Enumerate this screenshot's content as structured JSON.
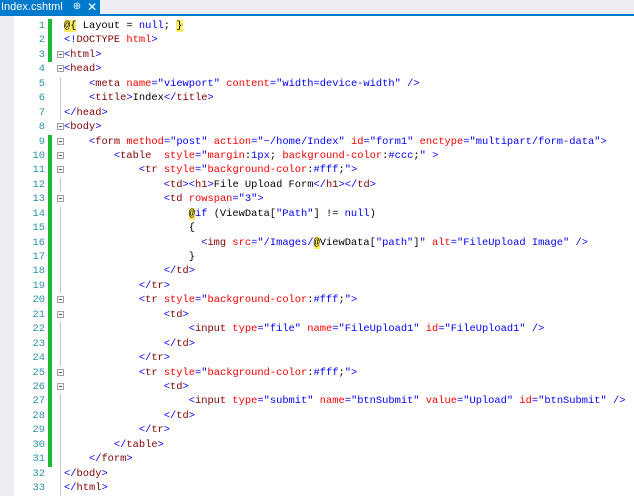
{
  "tab": {
    "title": "Index.cshtml",
    "pin": "⊕",
    "close": "✕"
  },
  "code": {
    "lines": [
      {
        "n": "1",
        "tokens": [
          [
            "r",
            "@{"
          ],
          [
            "x",
            " Layout = "
          ],
          [
            "k",
            "null"
          ],
          [
            "x",
            "; "
          ],
          [
            "r",
            "}"
          ]
        ]
      },
      {
        "n": "2",
        "tokens": [
          [
            "d",
            "<!"
          ],
          [
            "t",
            "DOCTYPE"
          ],
          [
            "x",
            " "
          ],
          [
            "a",
            "html"
          ],
          [
            "d",
            ">"
          ]
        ]
      },
      {
        "n": "3",
        "tokens": [
          [
            "d",
            "<"
          ],
          [
            "t",
            "html"
          ],
          [
            "d",
            ">"
          ]
        ]
      },
      {
        "n": "4",
        "tokens": [
          [
            "d",
            "<"
          ],
          [
            "t",
            "head"
          ],
          [
            "d",
            ">"
          ]
        ]
      },
      {
        "n": "5",
        "tokens": [
          [
            "x",
            "    "
          ],
          [
            "d",
            "<"
          ],
          [
            "t",
            "meta"
          ],
          [
            "x",
            " "
          ],
          [
            "a",
            "name"
          ],
          [
            "d",
            "="
          ],
          [
            "v",
            "\"viewport\""
          ],
          [
            "x",
            " "
          ],
          [
            "a",
            "content"
          ],
          [
            "d",
            "="
          ],
          [
            "v",
            "\"width=device-width\""
          ],
          [
            "x",
            " "
          ],
          [
            "d",
            "/>"
          ]
        ]
      },
      {
        "n": "6",
        "tokens": [
          [
            "x",
            "    "
          ],
          [
            "d",
            "<"
          ],
          [
            "t",
            "title"
          ],
          [
            "d",
            ">"
          ],
          [
            "x",
            "Index"
          ],
          [
            "d",
            "</"
          ],
          [
            "t",
            "title"
          ],
          [
            "d",
            ">"
          ]
        ]
      },
      {
        "n": "7",
        "tokens": [
          [
            "d",
            "</"
          ],
          [
            "t",
            "head"
          ],
          [
            "d",
            ">"
          ]
        ]
      },
      {
        "n": "8",
        "tokens": [
          [
            "d",
            "<"
          ],
          [
            "t",
            "body"
          ],
          [
            "d",
            ">"
          ]
        ]
      },
      {
        "n": "9",
        "tokens": [
          [
            "x",
            "    "
          ],
          [
            "d",
            "<"
          ],
          [
            "t",
            "form"
          ],
          [
            "x",
            " "
          ],
          [
            "a",
            "method"
          ],
          [
            "d",
            "="
          ],
          [
            "v",
            "\"post\""
          ],
          [
            "x",
            " "
          ],
          [
            "a",
            "action"
          ],
          [
            "d",
            "="
          ],
          [
            "v",
            "\"~/home/Index\""
          ],
          [
            "x",
            " "
          ],
          [
            "a",
            "id"
          ],
          [
            "d",
            "="
          ],
          [
            "v",
            "\"form1\""
          ],
          [
            "x",
            " "
          ],
          [
            "a",
            "enctype"
          ],
          [
            "d",
            "="
          ],
          [
            "v",
            "\"multipart/form-data\""
          ],
          [
            "d",
            ">"
          ]
        ]
      },
      {
        "n": "10",
        "tokens": [
          [
            "x",
            "        "
          ],
          [
            "d",
            "<"
          ],
          [
            "t",
            "table"
          ],
          [
            "x",
            "  "
          ],
          [
            "a",
            "style"
          ],
          [
            "d",
            "="
          ],
          [
            "v",
            "\""
          ],
          [
            "a",
            "margin"
          ],
          [
            "x",
            ":"
          ],
          [
            "v",
            "1px"
          ],
          [
            "x",
            "; "
          ],
          [
            "a",
            "background-color"
          ],
          [
            "x",
            ":"
          ],
          [
            "v",
            "#ccc"
          ],
          [
            "x",
            ";"
          ],
          [
            "v",
            "\""
          ],
          [
            "x",
            " "
          ],
          [
            "d",
            ">"
          ]
        ]
      },
      {
        "n": "11",
        "tokens": [
          [
            "x",
            "            "
          ],
          [
            "d",
            "<"
          ],
          [
            "t",
            "tr"
          ],
          [
            "x",
            " "
          ],
          [
            "a",
            "style"
          ],
          [
            "d",
            "="
          ],
          [
            "v",
            "\""
          ],
          [
            "a",
            "background-color"
          ],
          [
            "x",
            ":"
          ],
          [
            "v",
            "#fff"
          ],
          [
            "x",
            ";"
          ],
          [
            "v",
            "\""
          ],
          [
            "d",
            ">"
          ]
        ]
      },
      {
        "n": "12",
        "tokens": [
          [
            "x",
            "                "
          ],
          [
            "d",
            "<"
          ],
          [
            "t",
            "td"
          ],
          [
            "d",
            "><"
          ],
          [
            "t",
            "h1"
          ],
          [
            "d",
            ">"
          ],
          [
            "x",
            "File Upload Form"
          ],
          [
            "d",
            "</"
          ],
          [
            "t",
            "h1"
          ],
          [
            "d",
            "></"
          ],
          [
            "t",
            "td"
          ],
          [
            "d",
            ">"
          ]
        ]
      },
      {
        "n": "13",
        "tokens": [
          [
            "x",
            "                "
          ],
          [
            "d",
            "<"
          ],
          [
            "t",
            "td"
          ],
          [
            "x",
            " "
          ],
          [
            "a",
            "rowspan"
          ],
          [
            "d",
            "="
          ],
          [
            "v",
            "\"3\""
          ],
          [
            "d",
            ">"
          ]
        ]
      },
      {
        "n": "14",
        "tokens": [
          [
            "x",
            "                    "
          ],
          [
            "r",
            "@"
          ],
          [
            "k",
            "if"
          ],
          [
            "x",
            " (ViewData["
          ],
          [
            "v",
            "\"Path\""
          ],
          [
            "x",
            "] != "
          ],
          [
            "k",
            "null"
          ],
          [
            "x",
            ")"
          ]
        ]
      },
      {
        "n": "15",
        "tokens": [
          [
            "x",
            "                    {"
          ]
        ]
      },
      {
        "n": "16",
        "tokens": [
          [
            "x",
            "                      "
          ],
          [
            "d",
            "<"
          ],
          [
            "t",
            "img"
          ],
          [
            "x",
            " "
          ],
          [
            "a",
            "src"
          ],
          [
            "d",
            "="
          ],
          [
            "v",
            "\"/Images/"
          ],
          [
            "r",
            "@"
          ],
          [
            "x",
            "ViewData["
          ],
          [
            "v",
            "\"path\""
          ],
          [
            "x",
            "]"
          ],
          [
            "v",
            "\""
          ],
          [
            "x",
            " "
          ],
          [
            "a",
            "alt"
          ],
          [
            "d",
            "="
          ],
          [
            "v",
            "\"FileUpload Image\""
          ],
          [
            "x",
            " "
          ],
          [
            "d",
            "/>"
          ]
        ]
      },
      {
        "n": "17",
        "tokens": [
          [
            "x",
            "                    }"
          ]
        ]
      },
      {
        "n": "18",
        "tokens": [
          [
            "x",
            "                "
          ],
          [
            "d",
            "</"
          ],
          [
            "t",
            "td"
          ],
          [
            "d",
            ">"
          ]
        ]
      },
      {
        "n": "19",
        "tokens": [
          [
            "x",
            "            "
          ],
          [
            "d",
            "</"
          ],
          [
            "t",
            "tr"
          ],
          [
            "d",
            ">"
          ]
        ]
      },
      {
        "n": "20",
        "tokens": [
          [
            "x",
            "            "
          ],
          [
            "d",
            "<"
          ],
          [
            "t",
            "tr"
          ],
          [
            "x",
            " "
          ],
          [
            "a",
            "style"
          ],
          [
            "d",
            "="
          ],
          [
            "v",
            "\""
          ],
          [
            "a",
            "background-color"
          ],
          [
            "x",
            ":"
          ],
          [
            "v",
            "#fff"
          ],
          [
            "x",
            ";"
          ],
          [
            "v",
            "\""
          ],
          [
            "d",
            ">"
          ]
        ]
      },
      {
        "n": "21",
        "tokens": [
          [
            "x",
            "                "
          ],
          [
            "d",
            "<"
          ],
          [
            "t",
            "td"
          ],
          [
            "d",
            ">"
          ]
        ]
      },
      {
        "n": "22",
        "tokens": [
          [
            "x",
            "                    "
          ],
          [
            "d",
            "<"
          ],
          [
            "t",
            "input"
          ],
          [
            "x",
            " "
          ],
          [
            "a",
            "type"
          ],
          [
            "d",
            "="
          ],
          [
            "v",
            "\"file\""
          ],
          [
            "x",
            " "
          ],
          [
            "a",
            "name"
          ],
          [
            "d",
            "="
          ],
          [
            "v",
            "\"FileUpload1\""
          ],
          [
            "x",
            " "
          ],
          [
            "a",
            "id"
          ],
          [
            "d",
            "="
          ],
          [
            "v",
            "\"FileUpload1\""
          ],
          [
            "x",
            " "
          ],
          [
            "d",
            "/>"
          ]
        ]
      },
      {
        "n": "23",
        "tokens": [
          [
            "x",
            "                "
          ],
          [
            "d",
            "</"
          ],
          [
            "t",
            "td"
          ],
          [
            "d",
            ">"
          ]
        ]
      },
      {
        "n": "24",
        "tokens": [
          [
            "x",
            "            "
          ],
          [
            "d",
            "</"
          ],
          [
            "t",
            "tr"
          ],
          [
            "d",
            ">"
          ]
        ]
      },
      {
        "n": "25",
        "tokens": [
          [
            "x",
            "            "
          ],
          [
            "d",
            "<"
          ],
          [
            "t",
            "tr"
          ],
          [
            "x",
            " "
          ],
          [
            "a",
            "style"
          ],
          [
            "d",
            "="
          ],
          [
            "v",
            "\""
          ],
          [
            "a",
            "background-color"
          ],
          [
            "x",
            ":"
          ],
          [
            "v",
            "#fff"
          ],
          [
            "x",
            ";"
          ],
          [
            "v",
            "\""
          ],
          [
            "d",
            ">"
          ]
        ]
      },
      {
        "n": "26",
        "tokens": [
          [
            "x",
            "                "
          ],
          [
            "d",
            "<"
          ],
          [
            "t",
            "td"
          ],
          [
            "d",
            ">"
          ]
        ]
      },
      {
        "n": "27",
        "tokens": [
          [
            "x",
            "                    "
          ],
          [
            "d",
            "<"
          ],
          [
            "t",
            "input"
          ],
          [
            "x",
            " "
          ],
          [
            "a",
            "type"
          ],
          [
            "d",
            "="
          ],
          [
            "v",
            "\"submit\""
          ],
          [
            "x",
            " "
          ],
          [
            "a",
            "name"
          ],
          [
            "d",
            "="
          ],
          [
            "v",
            "\"btnSubmit\""
          ],
          [
            "x",
            " "
          ],
          [
            "a",
            "value"
          ],
          [
            "d",
            "="
          ],
          [
            "v",
            "\"Upload\""
          ],
          [
            "x",
            " "
          ],
          [
            "a",
            "id"
          ],
          [
            "d",
            "="
          ],
          [
            "v",
            "\"btnSubmit\""
          ],
          [
            "x",
            " "
          ],
          [
            "d",
            "/>"
          ]
        ]
      },
      {
        "n": "28",
        "tokens": [
          [
            "x",
            "                "
          ],
          [
            "d",
            "</"
          ],
          [
            "t",
            "td"
          ],
          [
            "d",
            ">"
          ]
        ]
      },
      {
        "n": "29",
        "tokens": [
          [
            "x",
            "            "
          ],
          [
            "d",
            "</"
          ],
          [
            "t",
            "tr"
          ],
          [
            "d",
            ">"
          ]
        ]
      },
      {
        "n": "30",
        "tokens": [
          [
            "x",
            "        "
          ],
          [
            "d",
            "</"
          ],
          [
            "t",
            "table"
          ],
          [
            "d",
            ">"
          ]
        ]
      },
      {
        "n": "31",
        "tokens": [
          [
            "x",
            "    "
          ],
          [
            "d",
            "</"
          ],
          [
            "t",
            "form"
          ],
          [
            "d",
            ">"
          ]
        ]
      },
      {
        "n": "32",
        "tokens": [
          [
            "d",
            "</"
          ],
          [
            "t",
            "body"
          ],
          [
            "d",
            ">"
          ]
        ]
      },
      {
        "n": "33",
        "tokens": [
          [
            "d",
            "</"
          ],
          [
            "t",
            "html"
          ],
          [
            "d",
            ">"
          ]
        ]
      }
    ],
    "changed_lines": [
      1,
      2,
      3,
      9,
      10,
      11,
      12,
      13,
      14,
      15,
      16,
      17,
      18,
      19,
      20,
      21,
      22,
      23,
      24,
      25,
      26,
      27,
      28,
      29,
      30,
      31
    ],
    "fold_lines": [
      3,
      4,
      8,
      9,
      10,
      11,
      13,
      20,
      21,
      25,
      26
    ],
    "change_color": "#1fb83a"
  }
}
